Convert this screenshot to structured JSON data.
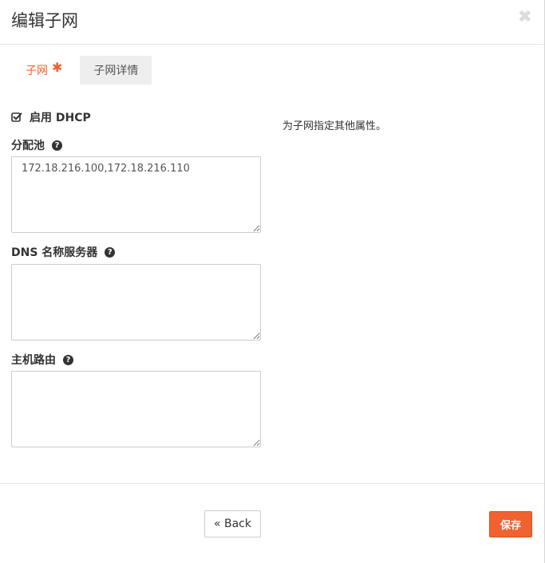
{
  "modal": {
    "title": "编辑子网",
    "close_glyph": "✖"
  },
  "tabs": [
    {
      "label": "子网",
      "required_mark": "✱",
      "active": true
    },
    {
      "label": "子网详情",
      "active": false
    }
  ],
  "form": {
    "dhcp": {
      "label": "启用 DHCP",
      "checked": true
    },
    "allocation_pools": {
      "label": "分配池",
      "value": "172.18.216.100,172.18.216.110"
    },
    "dns_servers": {
      "label": "DNS 名称服务器",
      "value": ""
    },
    "host_routes": {
      "label": "主机路由",
      "value": ""
    },
    "help_glyph": "?"
  },
  "help_text": "为子网指定其他属性。",
  "footer": {
    "back_label": "« Back",
    "save_label": "保存"
  },
  "colors": {
    "accent": "#f0622e",
    "inactive_tab_bg": "#eeeeee",
    "border": "#cccccc"
  },
  "icons": {
    "close": "close-icon",
    "checkbox": "checkbox-checked-icon",
    "help": "question-circle-icon",
    "required": "asterisk-icon"
  }
}
